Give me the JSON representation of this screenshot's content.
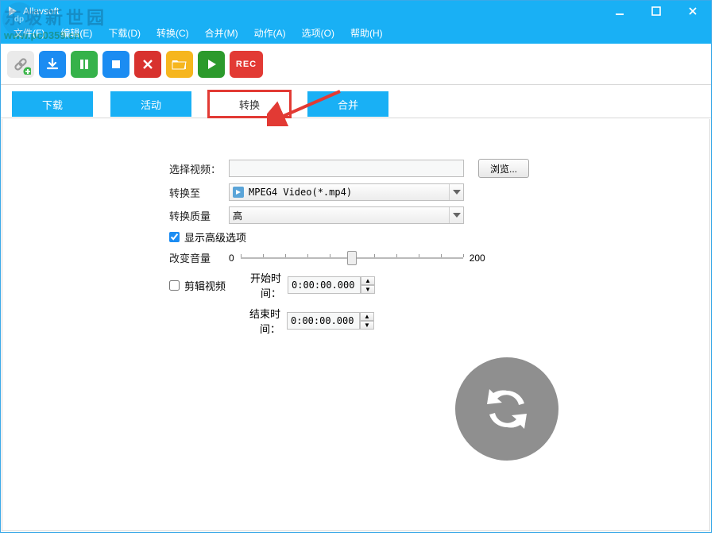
{
  "window": {
    "title": "Allavsoft"
  },
  "menu": {
    "items": [
      "文件(F)",
      "编辑(E)",
      "下载(D)",
      "转换(C)",
      "合并(M)",
      "动作(A)",
      "选项(O)",
      "帮助(H)"
    ]
  },
  "toolbar": {
    "rec_label": "REC"
  },
  "tabs": {
    "download": "下载",
    "activity": "活动",
    "convert": "转换",
    "merge": "合并"
  },
  "form": {
    "select_video_label": "选择视频：",
    "select_video_value": "",
    "browse_button": "浏览...",
    "convert_to_label": "转换至",
    "convert_to_value": "MPEG4 Video(*.mp4)",
    "quality_label": "转换质量",
    "quality_value": "高",
    "show_advanced_label": "显示高级选项",
    "show_advanced_checked": true,
    "volume_label": "改变音量",
    "volume_min": "0",
    "volume_max": "200",
    "volume_value": 100,
    "trim_label": "剪辑视频",
    "trim_checked": false,
    "start_time_label": "开始时间：",
    "start_time_value": "0:00:00.000",
    "end_time_label": "结束时间：",
    "end_time_value": "0:00:00.000"
  },
  "watermark": {
    "text_cn": "东坡新世园",
    "url": "www.pc0359.cn"
  }
}
